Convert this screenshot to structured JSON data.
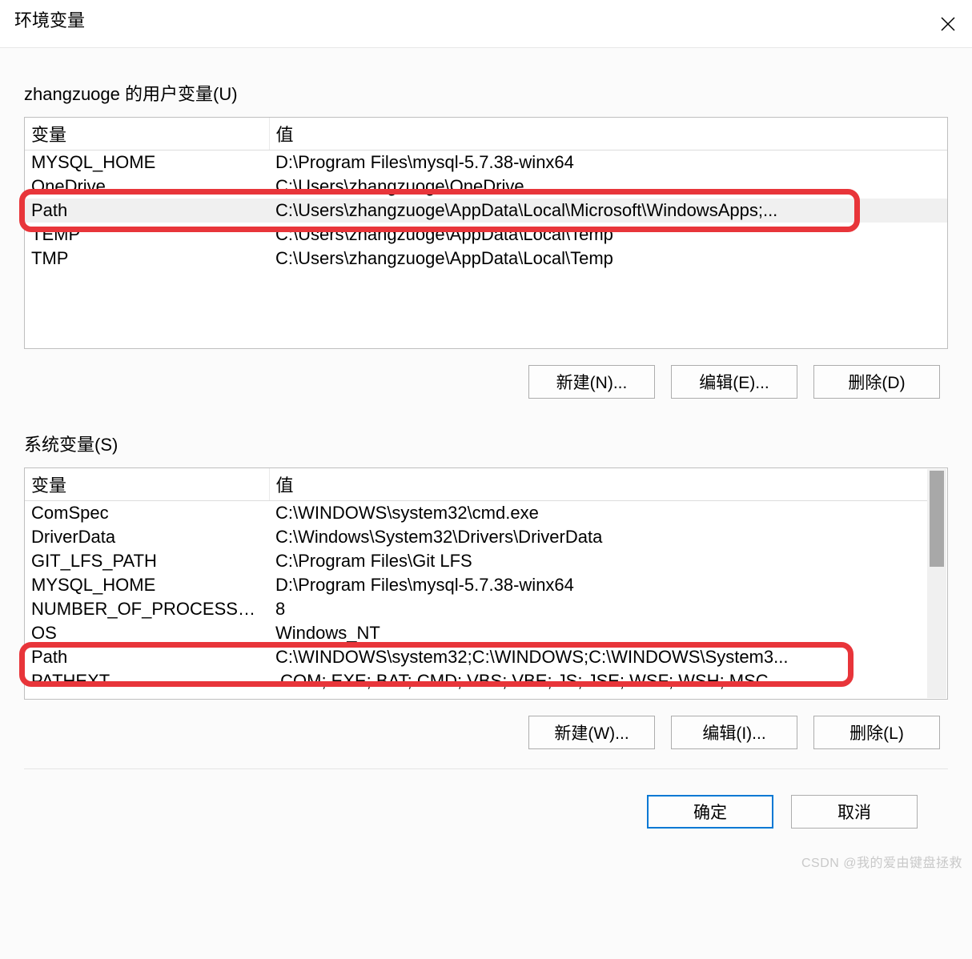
{
  "window": {
    "title": "环境变量"
  },
  "sections": {
    "user": {
      "label": "zhangzuoge 的用户变量(U)",
      "headers": {
        "var": "变量",
        "val": "值"
      },
      "rows": [
        {
          "var": "MYSQL_HOME",
          "val": "D:\\Program Files\\mysql-5.7.38-winx64"
        },
        {
          "var": "OneDrive",
          "val": "C:\\Users\\zhangzuoge\\OneDrive"
        },
        {
          "var": "Path",
          "val": "C:\\Users\\zhangzuoge\\AppData\\Local\\Microsoft\\WindowsApps;..."
        },
        {
          "var": "TEMP",
          "val": "C:\\Users\\zhangzuoge\\AppData\\Local\\Temp"
        },
        {
          "var": "TMP",
          "val": "C:\\Users\\zhangzuoge\\AppData\\Local\\Temp"
        }
      ],
      "buttons": {
        "new": "新建(N)...",
        "edit": "编辑(E)...",
        "delete": "删除(D)"
      }
    },
    "system": {
      "label": "系统变量(S)",
      "headers": {
        "var": "变量",
        "val": "值"
      },
      "rows": [
        {
          "var": "ComSpec",
          "val": "C:\\WINDOWS\\system32\\cmd.exe"
        },
        {
          "var": "DriverData",
          "val": "C:\\Windows\\System32\\Drivers\\DriverData"
        },
        {
          "var": "GIT_LFS_PATH",
          "val": "C:\\Program Files\\Git LFS"
        },
        {
          "var": "MYSQL_HOME",
          "val": "D:\\Program Files\\mysql-5.7.38-winx64"
        },
        {
          "var": "NUMBER_OF_PROCESSORS",
          "val": "8"
        },
        {
          "var": "OS",
          "val": "Windows_NT"
        },
        {
          "var": "Path",
          "val": "C:\\WINDOWS\\system32;C:\\WINDOWS;C:\\WINDOWS\\System3..."
        },
        {
          "var": "PATHEXT",
          "val": ".COM;.EXE;.BAT;.CMD;.VBS;.VBE;.JS;.JSE;.WSF;.WSH;.MSC"
        }
      ],
      "buttons": {
        "new": "新建(W)...",
        "edit": "编辑(I)...",
        "delete": "删除(L)"
      }
    }
  },
  "dialog_buttons": {
    "ok": "确定",
    "cancel": "取消"
  },
  "watermark": "CSDN @我的爱由键盘拯救"
}
